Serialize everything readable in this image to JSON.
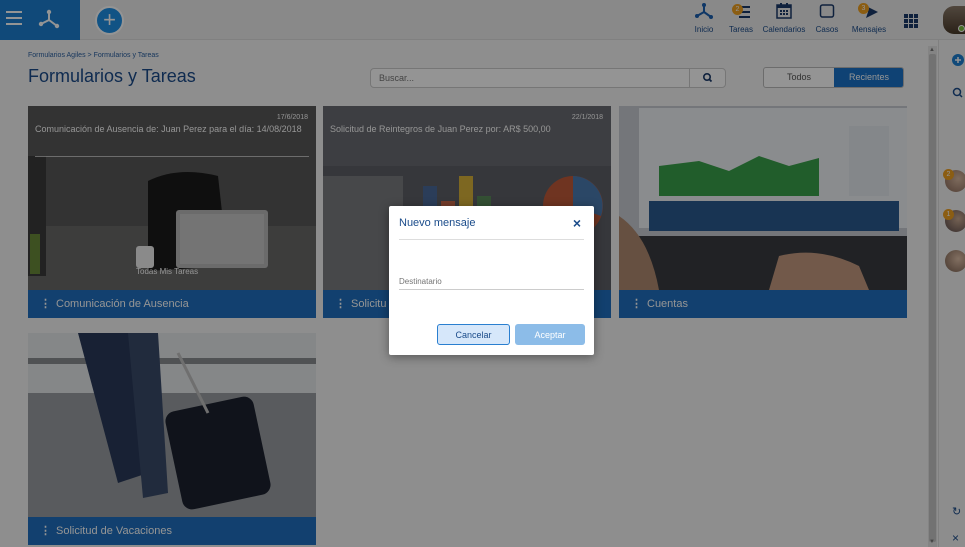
{
  "header": {
    "nav": [
      {
        "label": "Inicio",
        "icon": "home-network-icon",
        "badge": null
      },
      {
        "label": "Tareas",
        "icon": "tasks-icon",
        "badge": "2"
      },
      {
        "label": "Calendarios",
        "icon": "calendar-icon",
        "badge": null
      },
      {
        "label": "Casos",
        "icon": "cases-icon",
        "badge": null
      },
      {
        "label": "Mensajes",
        "icon": "messages-icon",
        "badge": "3"
      }
    ],
    "accent_color": "#1c7fd1"
  },
  "breadcrumb": {
    "items": [
      "Formularios Agiles",
      "Formularios y Tareas"
    ],
    "separator": " > "
  },
  "page": {
    "title": "Formularios y Tareas"
  },
  "search": {
    "placeholder": "Buscar..."
  },
  "filter": {
    "options": [
      "Todos",
      "Recientes"
    ],
    "selected": "Recientes"
  },
  "cards": [
    {
      "title": "Comunicación de Ausencia",
      "date": "17/6/2018",
      "description": "Comunicación de Ausencia de: Juan Perez para el día: 14/08/2018",
      "image_label": "Todas Mis Tareas"
    },
    {
      "title": "Solicitud de Reintegros",
      "visible_title": "Solicitu",
      "date": "22/1/2018",
      "description": "Solicitud de Reintegros de Juan Perez por: AR$ 500,00"
    },
    {
      "title": "Cuentas"
    },
    {
      "title": "Solicitud de Vacaciones"
    }
  ],
  "modal": {
    "title": "Nuevo mensaje",
    "recipient_placeholder": "Destinatario",
    "cancel_label": "Cancelar",
    "accept_label": "Aceptar"
  },
  "right_panel": {
    "contacts": [
      {
        "badge": "2"
      },
      {
        "badge": "1"
      },
      {
        "badge": null
      }
    ]
  }
}
